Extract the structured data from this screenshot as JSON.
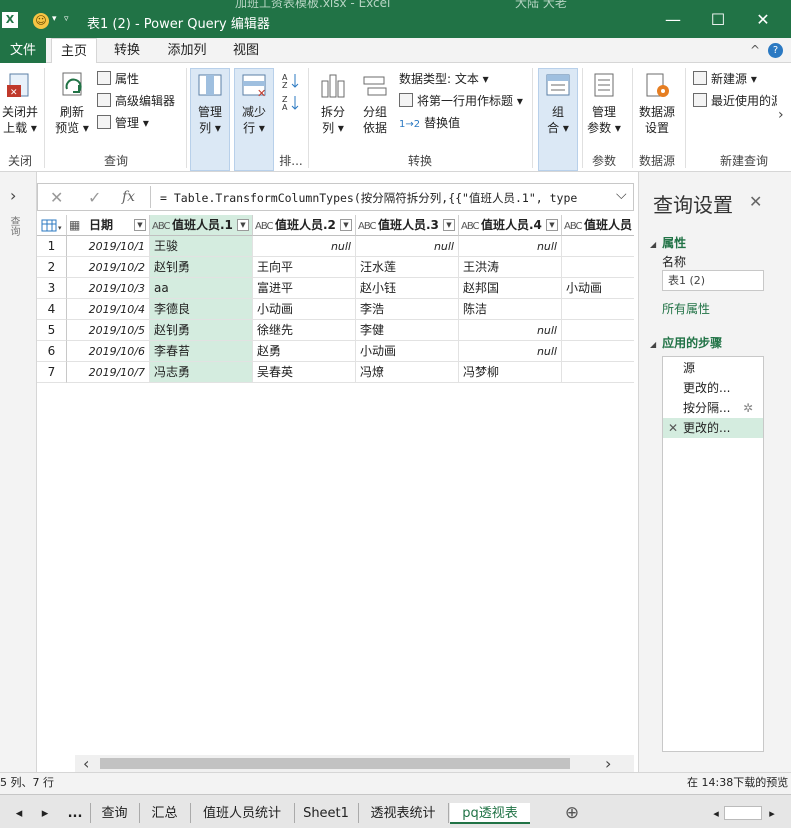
{
  "window": {
    "excel_title_ghost": [
      "加班工资表模板.xlsx  -  Excel",
      "大陆 大老"
    ],
    "title": "表1 (2) - Power Query 编辑器",
    "minimize": "—",
    "maximize": "☐",
    "close": "✕"
  },
  "menu": {
    "file": "文件",
    "tabs": [
      "主页",
      "转换",
      "添加列",
      "视图"
    ],
    "collapse": "^",
    "help": "?"
  },
  "ribbon": {
    "close_load": [
      "关闭并",
      "上载 ▾"
    ],
    "close_group": "关闭",
    "refresh": [
      "刷新",
      "预览 ▾"
    ],
    "properties": "属性",
    "advanced_editor": "高级编辑器",
    "manage": "管理 ▾",
    "query_group": "查询",
    "manage_columns": [
      "管理",
      "列 ▾"
    ],
    "reduce_rows": [
      "减少",
      "行 ▾"
    ],
    "sort_group": "排...",
    "split_column": [
      "拆分",
      "列 ▾"
    ],
    "group_by": [
      "分组",
      "依据"
    ],
    "data_type": "数据类型: 文本 ▾",
    "first_row_header": "将第一行用作标题 ▾",
    "replace_values": "替换值",
    "transform_group": "转换",
    "combine": [
      "组",
      "合 ▾"
    ],
    "manage_params": [
      "管理",
      "参数 ▾"
    ],
    "params_group": "参数",
    "data_source_settings": [
      "数据源",
      "设置"
    ],
    "data_source_group": "数据源",
    "new_source": "新建源 ▾",
    "recent_sources": "最近使用的源",
    "new_query_group": "新建查询",
    "more": "›"
  },
  "leftnav": {
    "expand": "›",
    "label": "查询"
  },
  "formula_bar": {
    "cancel": "✕",
    "commit": "✓",
    "fx": "fx",
    "text": "= Table.TransformColumnTypes(按分隔符拆分列,{{\"值班人员.1\", type",
    "expand": "⌵"
  },
  "grid": {
    "columns": [
      {
        "type_icon": "📅",
        "name": "日期"
      },
      {
        "type_icon": "ABC",
        "name": "值班人员.1"
      },
      {
        "type_icon": "ABC",
        "name": "值班人员.2"
      },
      {
        "type_icon": "ABC",
        "name": "值班人员.3"
      },
      {
        "type_icon": "ABC",
        "name": "值班人员.4"
      },
      {
        "type_icon": "ABC",
        "name": "值班人员"
      }
    ],
    "rows": [
      {
        "n": "1",
        "date": "2019/10/1",
        "c1": "王骏",
        "c2": "null",
        "c3": "null",
        "c4": "null",
        "c5": ""
      },
      {
        "n": "2",
        "date": "2019/10/2",
        "c1": "赵钊勇",
        "c2": "王向平",
        "c3": "汪水莲",
        "c4": "王洪涛",
        "c5": ""
      },
      {
        "n": "3",
        "date": "2019/10/3",
        "c1": "aa",
        "c2": "富进平",
        "c3": "赵小钰",
        "c4": "赵邦国",
        "c5": "小动画"
      },
      {
        "n": "4",
        "date": "2019/10/4",
        "c1": "李德良",
        "c2": "小动画",
        "c3": "李浩",
        "c4": "陈洁",
        "c5": ""
      },
      {
        "n": "5",
        "date": "2019/10/5",
        "c1": "赵钊勇",
        "c2": "徐继先",
        "c3": "李健",
        "c4": "null",
        "c5": ""
      },
      {
        "n": "6",
        "date": "2019/10/6",
        "c1": "李春苔",
        "c2": "赵勇",
        "c3": "小动画",
        "c4": "null",
        "c5": ""
      },
      {
        "n": "7",
        "date": "2019/10/7",
        "c1": "冯志勇",
        "c2": "吴春英",
        "c3": "冯燎",
        "c4": "冯梦柳",
        "c5": ""
      }
    ],
    "scroll_left": "‹",
    "scroll_right": "›"
  },
  "query_settings": {
    "title": "查询设置",
    "close": "✕",
    "properties_header": "属性",
    "name_label": "名称",
    "name_value": "表1 (2)",
    "all_properties": "所有属性",
    "applied_steps_header": "应用的步骤",
    "steps": [
      "源",
      "更改的...",
      "按分隔...",
      "更改的..."
    ],
    "step_gear": "✲",
    "step_delete": "✕"
  },
  "status": {
    "left": "5 列、7 行",
    "right": "在 14:38下载的预览"
  },
  "sheet_tabs": {
    "nav_prev": "◂",
    "nav_next": "▸",
    "ellipsis": "...",
    "tabs": [
      "查询",
      "汇总",
      "值班人员统计",
      "Sheet1",
      "透视表统计",
      "pq透视表"
    ],
    "add": "⊕",
    "scroll_left": "◂",
    "scroll_right": "▸"
  },
  "colors": {
    "excel_green": "#217346",
    "selected_col": "#d4ecdf",
    "ribbon_highlight": "#dbe8f5"
  }
}
